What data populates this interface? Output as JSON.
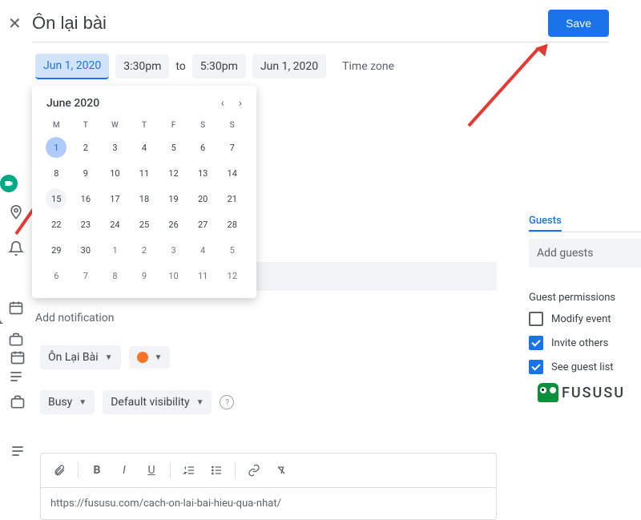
{
  "header": {
    "title": "Ôn lại bài",
    "save_label": "Save"
  },
  "datetime": {
    "start_date": "Jun 1, 2020",
    "start_time": "3:30pm",
    "to_label": "to",
    "end_time": "5:30pm",
    "end_date": "Jun 1, 2020",
    "timezone_label": "Time zone"
  },
  "calendar": {
    "title": "June 2020",
    "dow": [
      "M",
      "T",
      "W",
      "T",
      "F",
      "S",
      "S"
    ],
    "weeks": [
      [
        {
          "n": "1",
          "cls": "today"
        },
        {
          "n": "2"
        },
        {
          "n": "3"
        },
        {
          "n": "4"
        },
        {
          "n": "5"
        },
        {
          "n": "6"
        },
        {
          "n": "7"
        }
      ],
      [
        {
          "n": "8"
        },
        {
          "n": "9"
        },
        {
          "n": "10"
        },
        {
          "n": "11"
        },
        {
          "n": "12"
        },
        {
          "n": "13"
        },
        {
          "n": "14"
        }
      ],
      [
        {
          "n": "15",
          "cls": "hover"
        },
        {
          "n": "16"
        },
        {
          "n": "17"
        },
        {
          "n": "18"
        },
        {
          "n": "19"
        },
        {
          "n": "20"
        },
        {
          "n": "21"
        }
      ],
      [
        {
          "n": "22"
        },
        {
          "n": "23"
        },
        {
          "n": "24"
        },
        {
          "n": "25"
        },
        {
          "n": "26"
        },
        {
          "n": "27"
        },
        {
          "n": "28"
        }
      ],
      [
        {
          "n": "29"
        },
        {
          "n": "30"
        },
        {
          "n": "1",
          "cls": "muted"
        },
        {
          "n": "2",
          "cls": "muted"
        },
        {
          "n": "3",
          "cls": "muted"
        },
        {
          "n": "4",
          "cls": "muted"
        },
        {
          "n": "5",
          "cls": "muted"
        }
      ],
      [
        {
          "n": "6",
          "cls": "muted"
        },
        {
          "n": "7",
          "cls": "muted"
        },
        {
          "n": "8",
          "cls": "muted"
        },
        {
          "n": "9",
          "cls": "muted"
        },
        {
          "n": "10",
          "cls": "muted"
        },
        {
          "n": "11",
          "cls": "muted"
        },
        {
          "n": "12",
          "cls": "muted"
        }
      ]
    ]
  },
  "notification": {
    "add_label": "Add notification"
  },
  "calendar_row": {
    "name": "Ôn Lại Bài"
  },
  "availability": {
    "busy": "Busy",
    "visibility": "Default visibility"
  },
  "editor": {
    "content": "https://fususu.com/cach-on-lai-bai-hieu-qua-nhat/"
  },
  "guests": {
    "tab_label": "Guests",
    "add_placeholder": "Add guests",
    "permissions_title": "Guest permissions",
    "modify": "Modify event",
    "invite": "Invite others",
    "see": "See guest list"
  },
  "brand": "FUSUSU"
}
